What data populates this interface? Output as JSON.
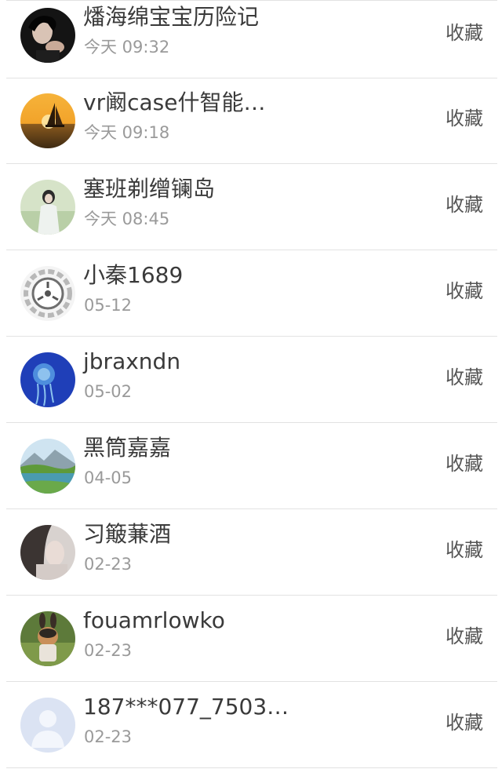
{
  "items": [
    {
      "title": "燔海绵宝宝历险记",
      "time": "今天 09:32",
      "action": "收藏",
      "avatar_icon": "girl-portrait-avatar"
    },
    {
      "title": "vr阚case什智能…",
      "time": "今天 09:18",
      "action": "收藏",
      "avatar_icon": "sunset-sailboat-avatar"
    },
    {
      "title": "塞班剃缯镧岛",
      "time": "今天 08:45",
      "action": "收藏",
      "avatar_icon": "girl-in-field-avatar"
    },
    {
      "title": "小秦1689",
      "time": "05-12",
      "action": "收藏",
      "avatar_icon": "scp-logo-avatar"
    },
    {
      "title": "jbraxndn",
      "time": "05-02",
      "action": "收藏",
      "avatar_icon": "jellyfish-avatar"
    },
    {
      "title": "黑筒嘉嘉",
      "time": "04-05",
      "action": "收藏",
      "avatar_icon": "mountain-lake-avatar"
    },
    {
      "title": "习簸蒹酒",
      "time": "02-23",
      "action": "收藏",
      "avatar_icon": "portrait-avatar"
    },
    {
      "title": "fouamrlowko",
      "time": "02-23",
      "action": "收藏",
      "avatar_icon": "rabbit-figure-avatar"
    },
    {
      "title": "187***077_7503…",
      "time": "02-23",
      "action": "收藏",
      "avatar_icon": "default-user-avatar"
    }
  ]
}
